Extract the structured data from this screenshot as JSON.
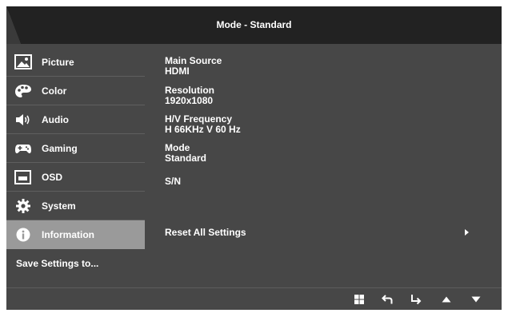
{
  "header": {
    "title": "Mode - Standard"
  },
  "sidebar": {
    "items": [
      {
        "label": "Picture",
        "icon": "picture-icon",
        "active": false
      },
      {
        "label": "Color",
        "icon": "palette-icon",
        "active": false
      },
      {
        "label": "Audio",
        "icon": "speaker-icon",
        "active": false
      },
      {
        "label": "Gaming",
        "icon": "gamepad-icon",
        "active": false
      },
      {
        "label": "OSD",
        "icon": "osd-window-icon",
        "active": false
      },
      {
        "label": "System",
        "icon": "gear-icon",
        "active": false
      },
      {
        "label": "Information",
        "icon": "info-icon",
        "active": true
      }
    ],
    "save_settings": "Save Settings to..."
  },
  "info": {
    "main_source_label": "Main Source",
    "main_source_value": "HDMI",
    "resolution_label": "Resolution",
    "resolution_value": "1920x1080",
    "frequency_label": "H/V Frequency",
    "frequency_value": "H 66KHz V 60 Hz",
    "mode_label": "Mode",
    "mode_value": "Standard",
    "sn_label": "S/N",
    "reset_label": "Reset All Settings"
  },
  "footer": {
    "buttons": [
      "menu-grid-icon",
      "back-icon",
      "enter-icon",
      "up-arrow-icon",
      "down-arrow-icon"
    ]
  },
  "colors": {
    "background": "#474747",
    "header": "#222222",
    "active_item": "#9a9a9a",
    "text": "#ffffff"
  }
}
